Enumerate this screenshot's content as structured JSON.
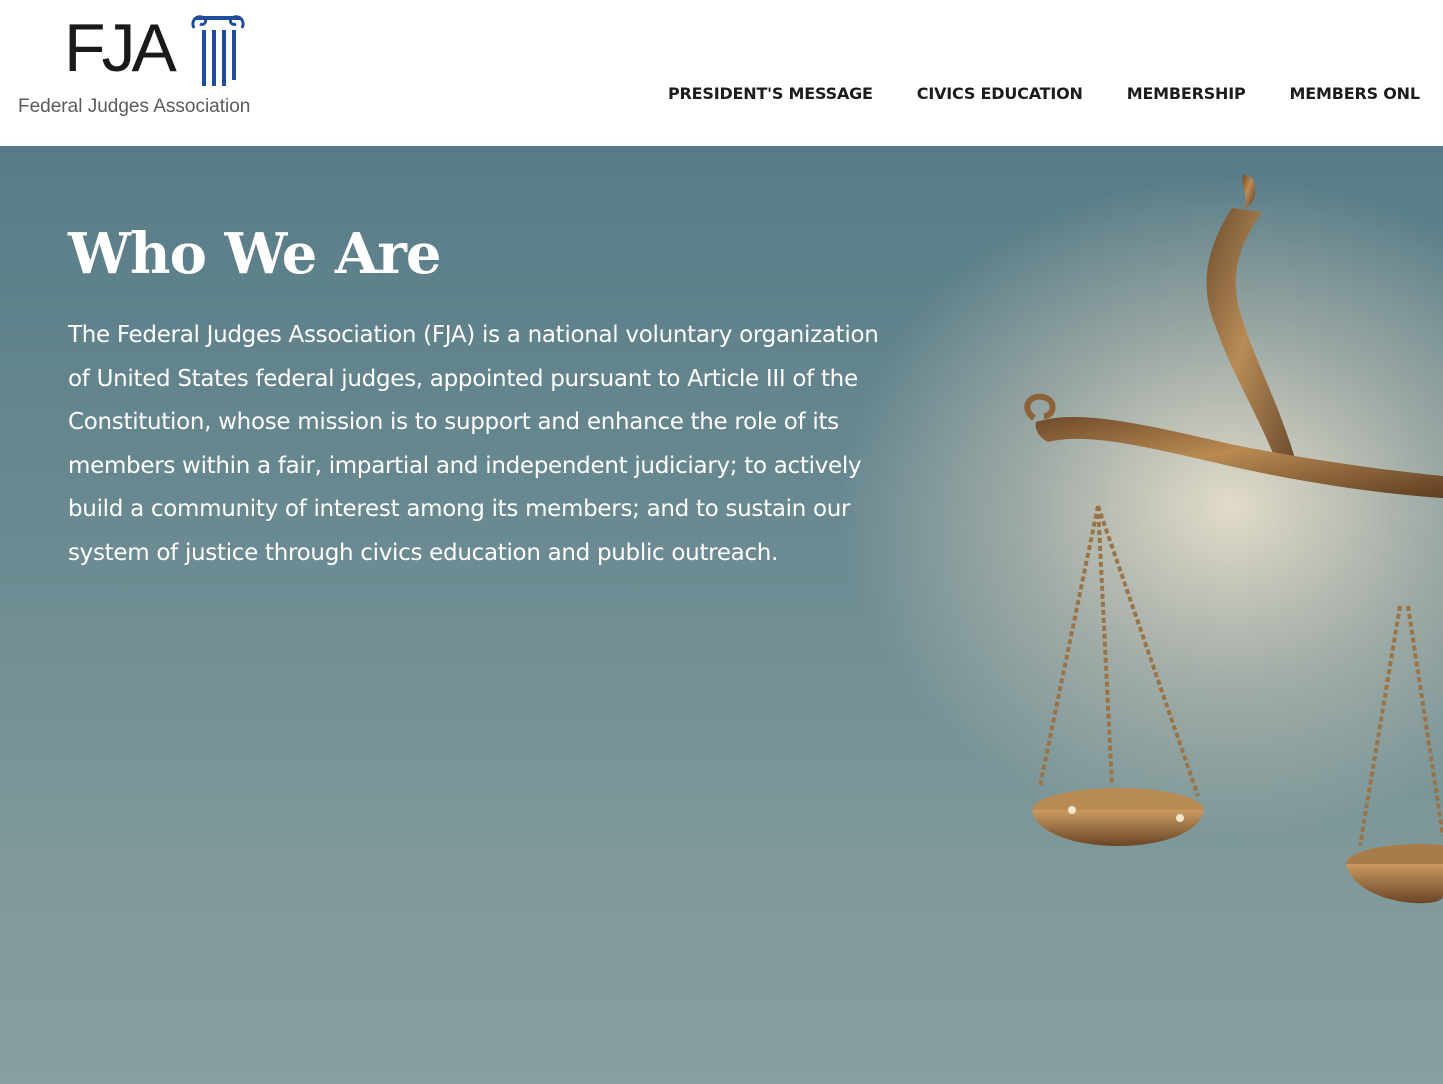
{
  "header": {
    "logo": {
      "letters": "FJA",
      "tagline": "Federal Judges Association",
      "icon": "ionic-column-icon"
    },
    "nav": [
      {
        "label": "PRESIDENT'S MESSAGE"
      },
      {
        "label": "CIVICS EDUCATION"
      },
      {
        "label": "MEMBERSHIP"
      },
      {
        "label": "MEMBERS ONL"
      }
    ]
  },
  "hero": {
    "title": "Who We Are",
    "body": "The Federal Judges Association (FJA) is a national voluntary organization of United States federal judges, appointed pursuant to Article III of the Constitution, whose mission is to support and enhance the role of its members within a fair, impartial and independent judiciary; to actively build a community of interest among its members; and to sustain our system of justice through civics education and public outreach.",
    "image": "scales-of-justice"
  },
  "colors": {
    "logo_accent": "#1f4e9c",
    "hero_background": "#6a8a91",
    "hero_text": "#ffffff",
    "nav_text": "#1c1c1c"
  }
}
